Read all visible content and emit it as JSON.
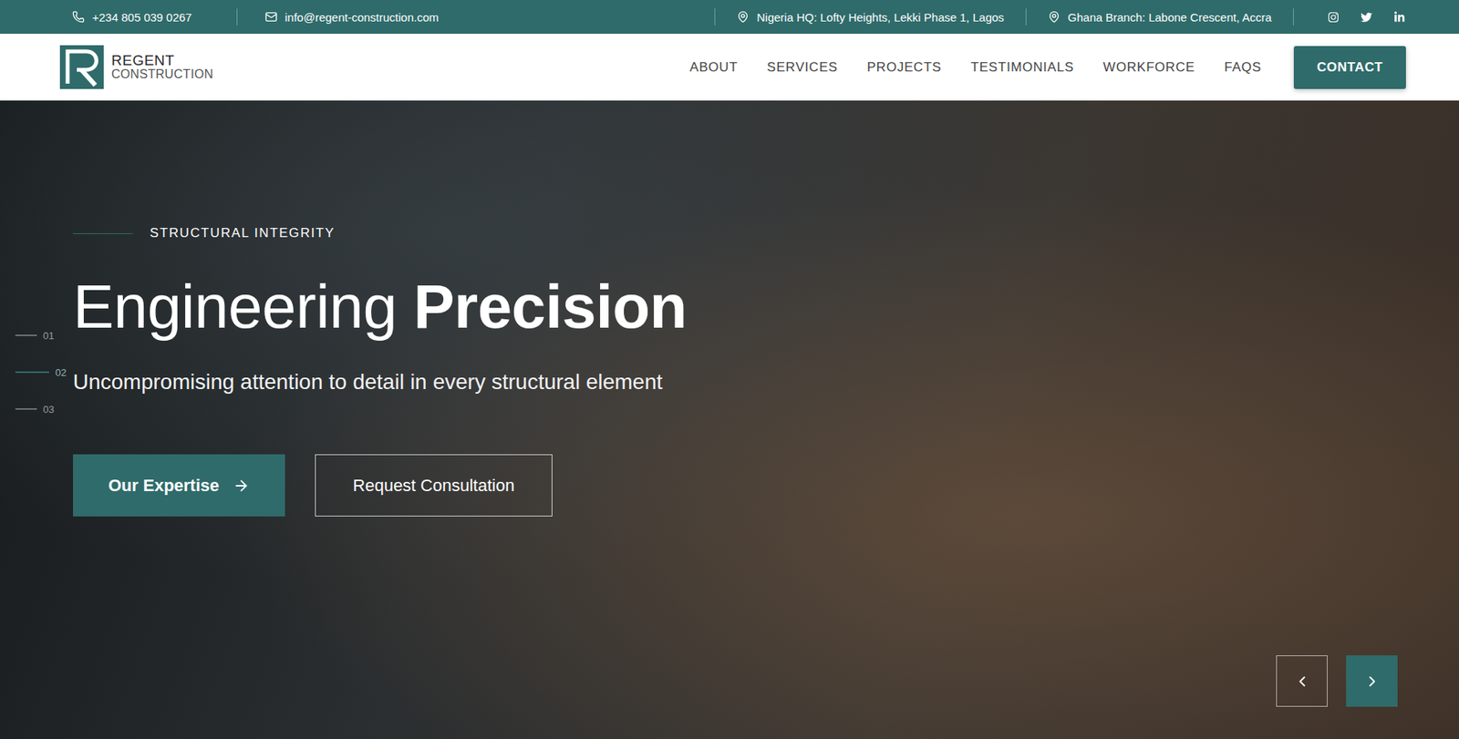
{
  "topbar": {
    "phone": "+234 805 039 0267",
    "email": "info@regent-construction.com",
    "locations": [
      "Nigeria HQ: Lofty Heights, Lekki Phase 1, Lagos",
      "Ghana Branch: Labone Crescent, Accra"
    ]
  },
  "logo": {
    "name": "REGENT",
    "tagline": "CONSTRUCTION"
  },
  "nav": {
    "items": [
      "ABOUT",
      "SERVICES",
      "PROJECTS",
      "TESTIMONIALS",
      "WORKFORCE",
      "FAQS"
    ],
    "cta": "CONTACT"
  },
  "hero": {
    "eyebrow": "STRUCTURAL INTEGRITY",
    "title_light": "Engineering",
    "title_bold": "Precision",
    "subtitle": "Uncompromising attention to detail in every structural element",
    "buttons": [
      {
        "label": "Our Expertise",
        "kind": "primary"
      },
      {
        "label": "Request Consultation",
        "kind": "outline"
      }
    ],
    "slides": [
      {
        "number": "01",
        "selected": false
      },
      {
        "number": "02",
        "selected": true
      },
      {
        "number": "03",
        "selected": false
      }
    ]
  }
}
